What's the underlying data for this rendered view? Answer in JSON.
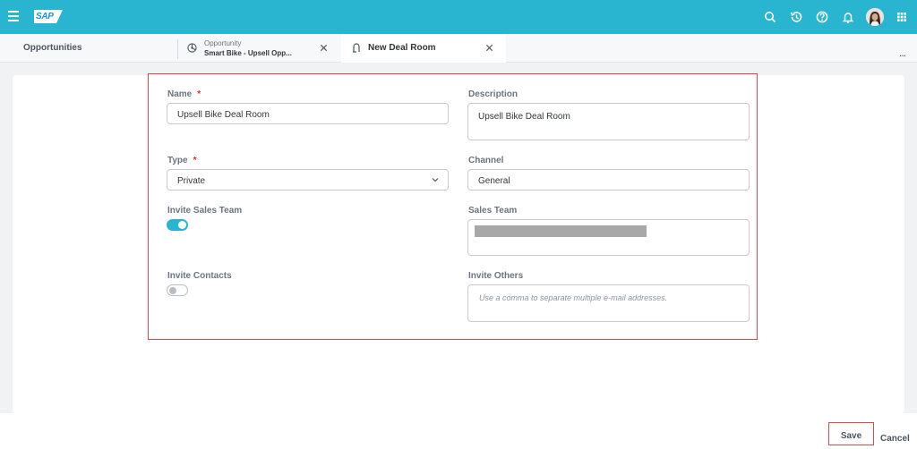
{
  "shell": {
    "logo_text": "SAP",
    "icons": [
      "menu-icon",
      "search-icon",
      "history-icon",
      "help-icon",
      "notification-icon",
      "avatar",
      "app-grid-icon"
    ]
  },
  "tabs": {
    "home": "Opportunities",
    "opportunity": {
      "type": "Opportunity",
      "title": "Smart Bike - Upsell Opp..."
    },
    "active": "New Deal Room",
    "overflow": "..."
  },
  "form": {
    "name": {
      "label": "Name",
      "required": "*",
      "value": "Upsell Bike Deal Room"
    },
    "description": {
      "label": "Description",
      "value": "Upsell Bike Deal Room"
    },
    "type": {
      "label": "Type",
      "required": "*",
      "value": "Private"
    },
    "channel": {
      "label": "Channel",
      "value": "General"
    },
    "invite_sales_team": {
      "label": "Invite Sales Team",
      "on": true
    },
    "sales_team": {
      "label": "Sales Team"
    },
    "invite_contacts": {
      "label": "Invite Contacts",
      "on": false
    },
    "invite_others": {
      "label": "Invite Others",
      "placeholder": "Use a comma to separate multiple e-mail addresses."
    }
  },
  "footer": {
    "save": "Save",
    "cancel": "Cancel"
  },
  "colors": {
    "shell": "#29b4cf",
    "highlight": "#e0474c",
    "toggle_on": "#29b4cf"
  }
}
